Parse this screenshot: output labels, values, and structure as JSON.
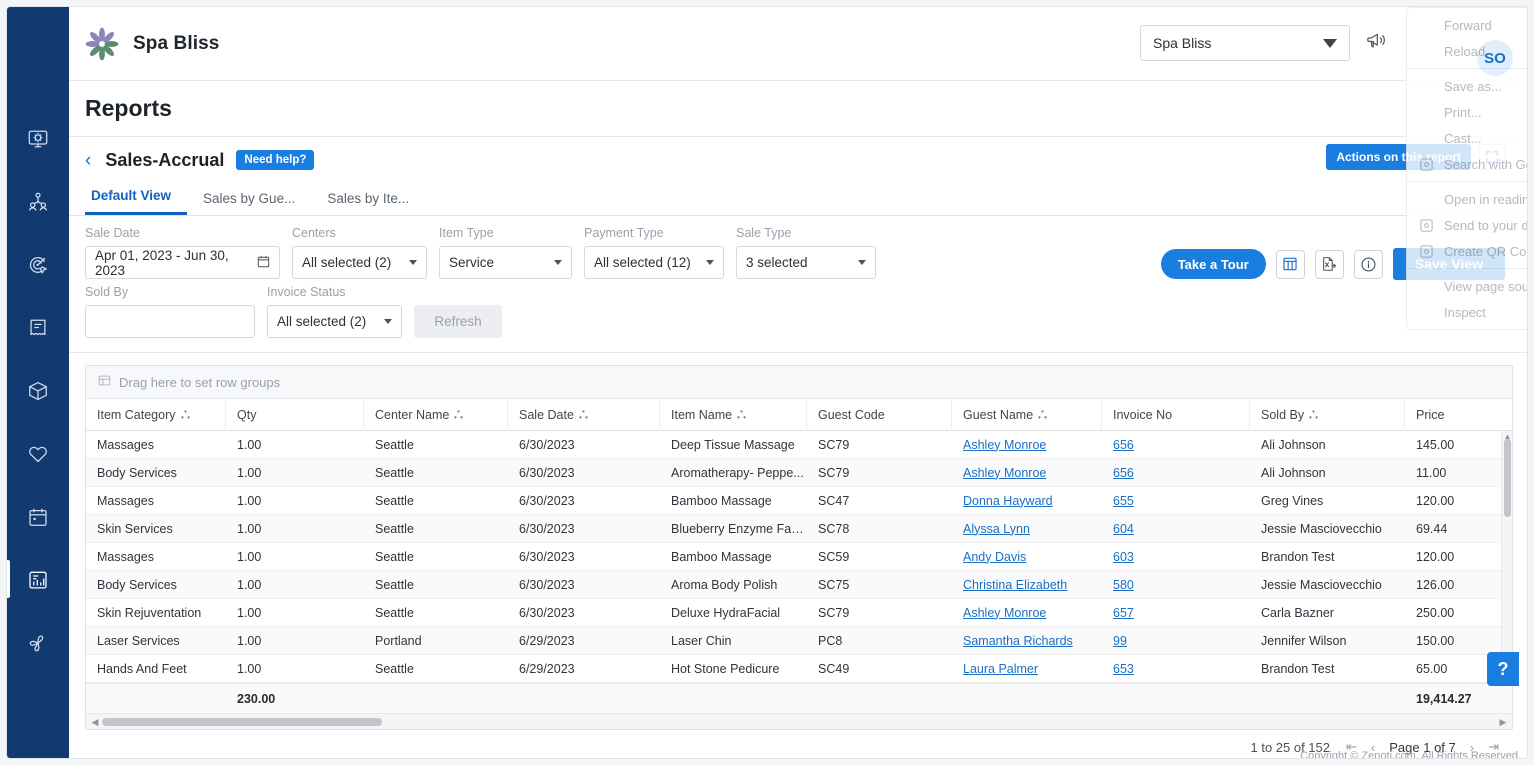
{
  "sidebar": {
    "items": [
      {
        "name": "dashboard",
        "icon": "monitor-gear-icon"
      },
      {
        "name": "employees",
        "icon": "people-icon"
      },
      {
        "name": "marketing",
        "icon": "target-icon"
      },
      {
        "name": "invoices",
        "icon": "receipt-icon"
      },
      {
        "name": "inventory",
        "icon": "package-icon"
      },
      {
        "name": "loyalty",
        "icon": "heart-icon"
      },
      {
        "name": "appointments",
        "icon": "calendar-icon"
      },
      {
        "name": "reports",
        "icon": "report-chart-icon",
        "active": true
      },
      {
        "name": "settings",
        "icon": "fan-icon"
      }
    ]
  },
  "topbar": {
    "brand_name": "Spa Bliss",
    "logo_icon": "flower-logo-icon",
    "center_select_value": "Spa Bliss",
    "announcement_icon": "megaphone-icon"
  },
  "page": {
    "title": "Reports"
  },
  "report": {
    "back_icon": "chevron-left-icon",
    "name": "Sales-Accrual",
    "need_help_label": "Need help?",
    "actions_label": "Actions on this report",
    "expand_icon": "expand-fullscreen-icon",
    "tabs": [
      {
        "label": "Default View",
        "active": true
      },
      {
        "label": "Sales by Gue...",
        "active": false
      },
      {
        "label": "Sales by Ite...",
        "active": false
      }
    ]
  },
  "filters": {
    "sale_date": {
      "label": "Sale Date",
      "value": "Apr 01, 2023 - Jun 30, 2023",
      "icon": "calendar-icon"
    },
    "centers": {
      "label": "Centers",
      "value": "All selected (2)"
    },
    "item_type": {
      "label": "Item Type",
      "value": "Service"
    },
    "payment_type": {
      "label": "Payment Type",
      "value": "All selected (12)"
    },
    "sale_type": {
      "label": "Sale Type",
      "value": "3 selected"
    },
    "sold_by": {
      "label": "Sold By",
      "value": "",
      "placeholder": ""
    },
    "invoice_status": {
      "label": "Invoice Status",
      "value": "All selected (2)"
    },
    "refresh_label": "Refresh",
    "tour_label": "Take a Tour",
    "columns_icon": "columns-grid-icon",
    "export_icon": "export-excel-icon",
    "info_icon": "info-circle-icon",
    "save_view_label": "Save View"
  },
  "grid": {
    "rowgroup_text": "Drag here to set row groups",
    "rowgroup_icon": "group-panel-icon",
    "group_icon": "group-column-icon",
    "columns": [
      {
        "label": "Item Category",
        "groupable": true,
        "cls": "c-cat"
      },
      {
        "label": "Qty",
        "groupable": false,
        "cls": "c-qty"
      },
      {
        "label": "Center Name",
        "groupable": true,
        "cls": "c-center"
      },
      {
        "label": "Sale Date",
        "groupable": true,
        "cls": "c-date"
      },
      {
        "label": "Item Name",
        "groupable": true,
        "cls": "c-item"
      },
      {
        "label": "Guest Code",
        "groupable": false,
        "cls": "c-gcode"
      },
      {
        "label": "Guest Name",
        "groupable": true,
        "cls": "c-gname"
      },
      {
        "label": "Invoice No",
        "groupable": false,
        "cls": "c-inv"
      },
      {
        "label": "Sold By",
        "groupable": true,
        "cls": "c-sold"
      },
      {
        "label": "Price",
        "groupable": false,
        "cls": "c-price"
      }
    ],
    "rows": [
      {
        "item_category": "Massages",
        "qty": "1.00",
        "center_name": "Seattle",
        "sale_date": "6/30/2023",
        "item_name": "Deep Tissue Massage",
        "guest_code": "SC79",
        "guest_name": "Ashley Monroe",
        "invoice_no": "656",
        "sold_by": "Ali Johnson",
        "price": "145.00"
      },
      {
        "item_category": "Body Services",
        "qty": "1.00",
        "center_name": "Seattle",
        "sale_date": "6/30/2023",
        "item_name": "Aromatherapy- Peppe...",
        "guest_code": "SC79",
        "guest_name": "Ashley Monroe",
        "invoice_no": "656",
        "sold_by": "Ali Johnson",
        "price": "11.00"
      },
      {
        "item_category": "Massages",
        "qty": "1.00",
        "center_name": "Seattle",
        "sale_date": "6/30/2023",
        "item_name": "Bamboo Massage",
        "guest_code": "SC47",
        "guest_name": "Donna Hayward",
        "invoice_no": "655",
        "sold_by": "Greg Vines",
        "price": "120.00"
      },
      {
        "item_category": "Skin Services",
        "qty": "1.00",
        "center_name": "Seattle",
        "sale_date": "6/30/2023",
        "item_name": "Blueberry Enzyme Fac...",
        "guest_code": "SC78",
        "guest_name": "Alyssa Lynn",
        "invoice_no": "604",
        "sold_by": "Jessie Masciovecchio",
        "price": "69.44"
      },
      {
        "item_category": "Massages",
        "qty": "1.00",
        "center_name": "Seattle",
        "sale_date": "6/30/2023",
        "item_name": "Bamboo Massage",
        "guest_code": "SC59",
        "guest_name": "Andy Davis",
        "invoice_no": "603",
        "sold_by": "Brandon Test",
        "price": "120.00"
      },
      {
        "item_category": "Body Services",
        "qty": "1.00",
        "center_name": "Seattle",
        "sale_date": "6/30/2023",
        "item_name": "Aroma Body Polish",
        "guest_code": "SC75",
        "guest_name": "Christina Elizabeth",
        "invoice_no": "580",
        "sold_by": "Jessie Masciovecchio",
        "price": "126.00"
      },
      {
        "item_category": "Skin Rejuventation",
        "qty": "1.00",
        "center_name": "Seattle",
        "sale_date": "6/30/2023",
        "item_name": "Deluxe HydraFacial",
        "guest_code": "SC79",
        "guest_name": "Ashley Monroe",
        "invoice_no": "657",
        "sold_by": "Carla Bazner",
        "price": "250.00"
      },
      {
        "item_category": "Laser Services",
        "qty": "1.00",
        "center_name": "Portland",
        "sale_date": "6/29/2023",
        "item_name": "Laser Chin",
        "guest_code": "PC8",
        "guest_name": "Samantha Richards",
        "invoice_no": "99",
        "sold_by": "Jennifer Wilson",
        "price": "150.00"
      },
      {
        "item_category": "Hands And Feet",
        "qty": "1.00",
        "center_name": "Seattle",
        "sale_date": "6/29/2023",
        "item_name": "Hot Stone Pedicure",
        "guest_code": "SC49",
        "guest_name": "Laura Palmer",
        "invoice_no": "653",
        "sold_by": "Brandon Test",
        "price": "65.00"
      }
    ],
    "totals": {
      "qty": "230.00",
      "price": "19,414.27"
    }
  },
  "footer": {
    "range_text": "1 to 25 of 152",
    "first_icon": "first-page-icon",
    "prev_icon": "prev-page-icon",
    "page_text": "Page 1 of 7",
    "next_icon": "next-page-icon",
    "last_icon": "last-page-icon",
    "copyright": "Copyright © Zenoti.com. All Rights Reserved."
  },
  "help_fab": {
    "label": "?"
  },
  "context_menu": {
    "avatar_initials": "SO",
    "items": [
      {
        "label": "Forward",
        "sep_after": false
      },
      {
        "label": "Reload",
        "sep_after": true
      },
      {
        "label": "Save as...",
        "sep_after": false
      },
      {
        "label": "Print...",
        "sep_after": false
      },
      {
        "label": "Cast...",
        "sep_after": false
      },
      {
        "label": "Search with Go",
        "icon": "google-lens-icon",
        "sep_after": true
      },
      {
        "label": "Open in readin",
        "sep_after": false
      },
      {
        "label": "Send to your d",
        "icon": "device-icon",
        "sep_after": false
      },
      {
        "label": "Create QR Cod",
        "icon": "qr-code-icon",
        "sep_after": true
      },
      {
        "label": "View page sou",
        "sep_after": false
      },
      {
        "label": "Inspect",
        "sep_after": false
      }
    ]
  },
  "colors": {
    "rail": "#123a70",
    "accent": "#1a7ee0",
    "link": "#1a6fc4",
    "tab_active": "#1163bf"
  }
}
